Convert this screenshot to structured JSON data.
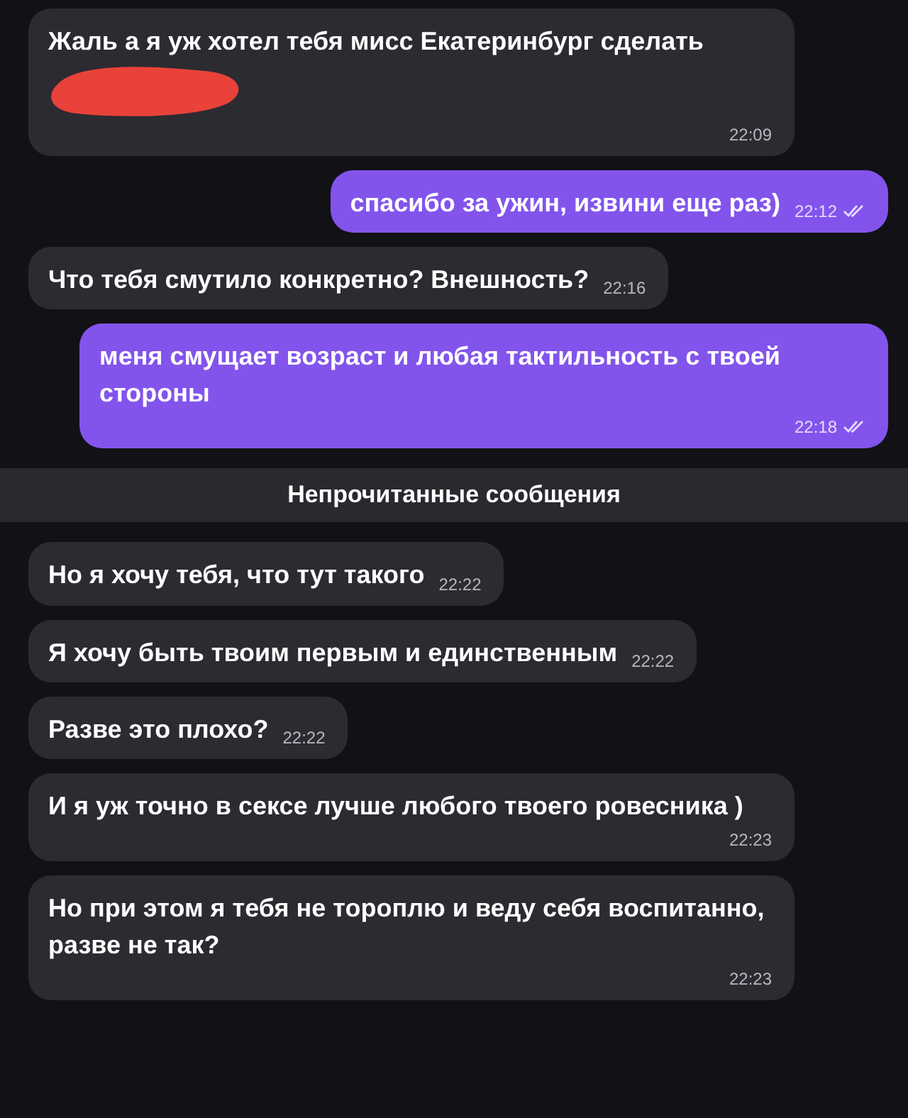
{
  "messages": [
    {
      "kind": "incoming",
      "text": "Жаль а я уж хотел тебя мисс Екатеринбург сделать",
      "time": "22:09",
      "redacted": true
    },
    {
      "kind": "outgoing",
      "text": "спасибо за ужин, извини еще раз)",
      "time": "22:12",
      "read": true
    },
    {
      "kind": "incoming",
      "text": "Что тебя смутило конкретно? Внешность?",
      "time": "22:16"
    },
    {
      "kind": "outgoing",
      "text": "меня смущает возраст и любая тактильность с твоей стороны",
      "time": "22:18",
      "read": true
    },
    {
      "kind": "divider",
      "text": "Непрочитанные сообщения"
    },
    {
      "kind": "incoming",
      "text": "Но я хочу тебя, что тут такого",
      "time": "22:22"
    },
    {
      "kind": "incoming",
      "text": "Я хочу быть твоим первым и единственным",
      "time": "22:22"
    },
    {
      "kind": "incoming",
      "text": "Разве это плохо?",
      "time": "22:22"
    },
    {
      "kind": "incoming",
      "text": "И я уж точно в сексе лучше любого твоего ровесника )",
      "time": "22:23"
    },
    {
      "kind": "incoming",
      "text": "Но при этом я тебя не тороплю и веду себя воспитанно, разве не так?",
      "time": "22:23"
    }
  ]
}
